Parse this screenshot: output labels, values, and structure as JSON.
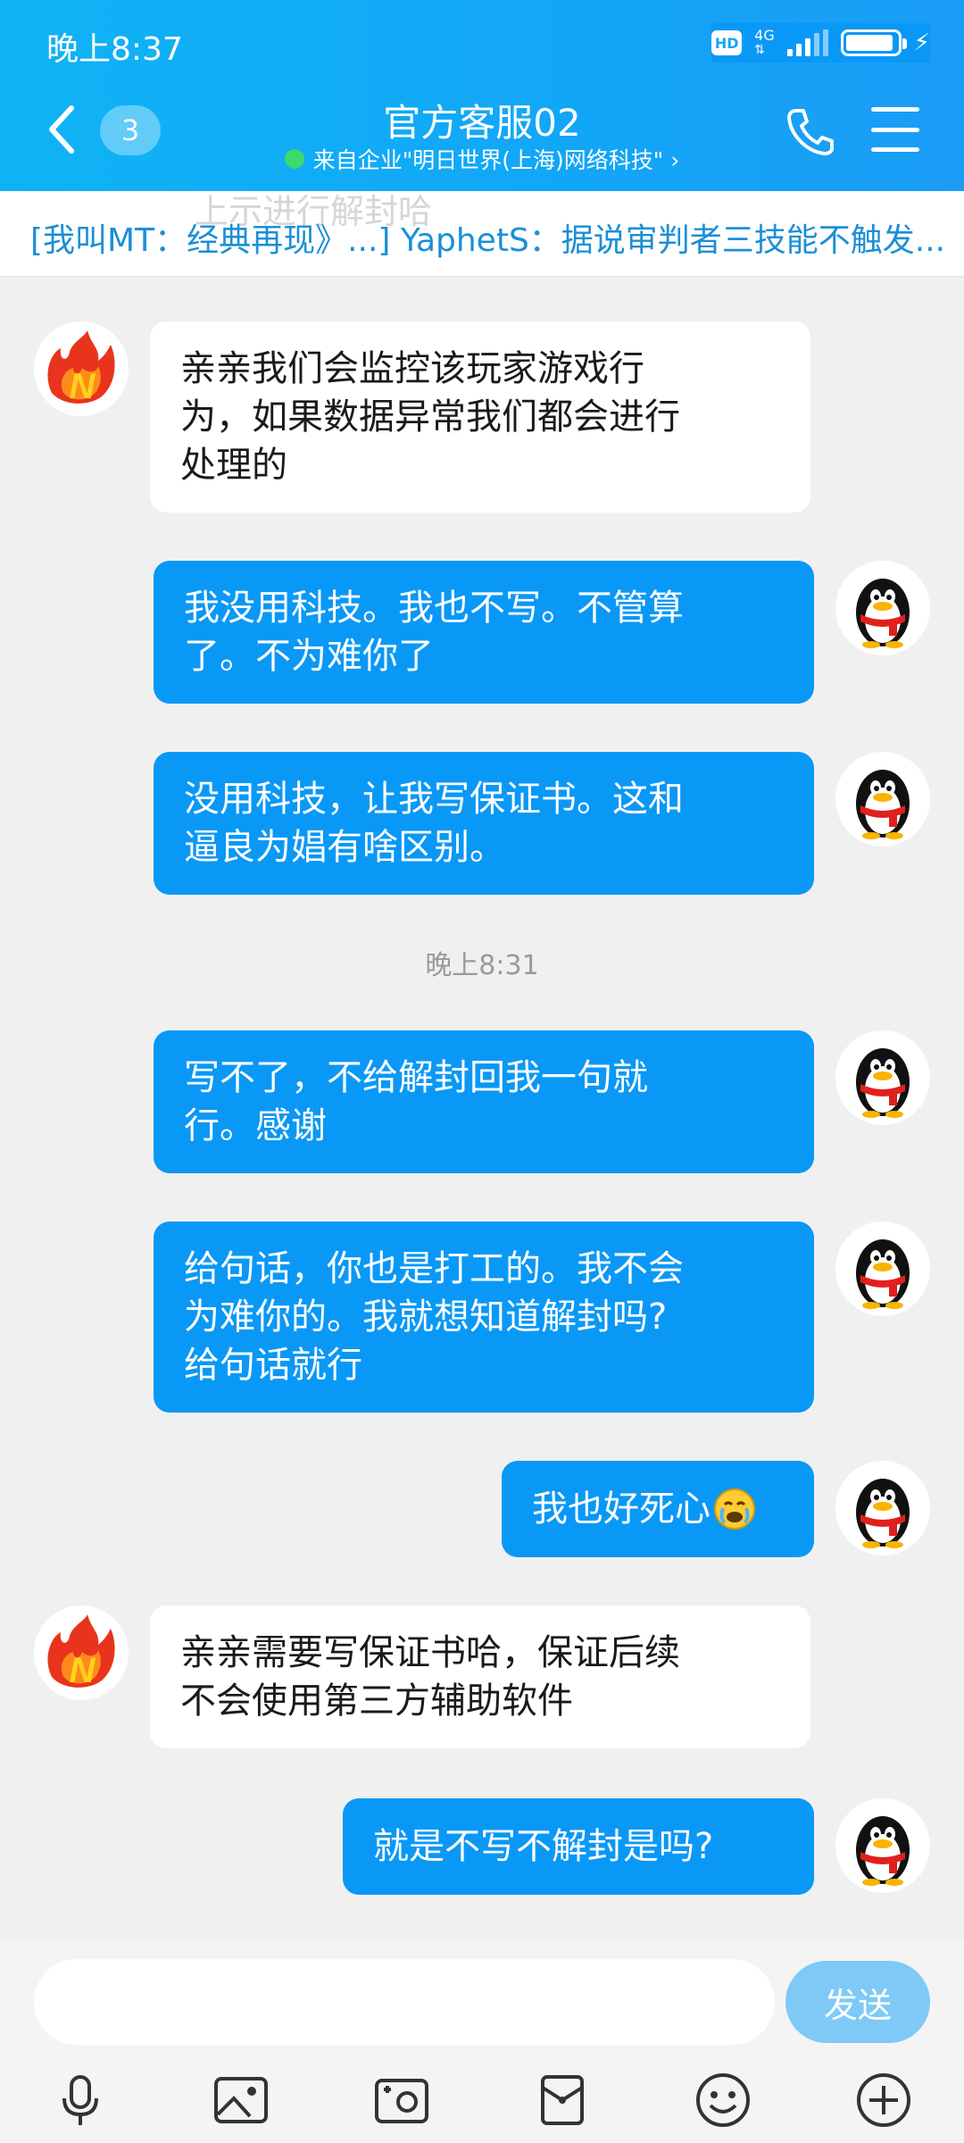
{
  "status_bar": {
    "time": "晚上8:37",
    "hd": "HD",
    "net": "4G"
  },
  "header": {
    "back_badge": "3",
    "title": "官方客服02",
    "subtitle": "来自企业\"明日世界(上海)网络科技\" ›"
  },
  "ticker": {
    "ghost_text": "上示进行解封哈",
    "text": "[我叫MT：经典再现》...] YaphetS：据说审判者三技能不触发..."
  },
  "messages": [
    {
      "side": "left",
      "lines": [
        "亲亲我们会监控该玩家游戏行",
        "为，如果数据异常我们都会进行",
        "处理的"
      ]
    },
    {
      "side": "right",
      "lines": [
        "我没用科技。我也不写。不管算",
        "了。不为难你了"
      ]
    },
    {
      "side": "right",
      "lines": [
        "没用科技，让我写保证书。这和",
        "逼良为娼有啥区别。"
      ]
    },
    {
      "side": "right",
      "lines": [
        "写不了，不给解封回我一句就",
        "行。感谢"
      ]
    },
    {
      "side": "right",
      "lines": [
        "给句话，你也是打工的。我不会",
        "为难你的。我就想知道解封吗?",
        "给句话就行"
      ]
    },
    {
      "side": "right",
      "lines": [
        "我也好死心"
      ],
      "emoji": "crying-face"
    },
    {
      "side": "left",
      "lines": [
        "亲亲需要写保证书哈，保证后续",
        "不会使用第三方辅助软件"
      ]
    },
    {
      "side": "right",
      "lines": [
        "就是不写不解封是吗?"
      ]
    }
  ],
  "timestamp": "晚上8:31",
  "composer": {
    "placeholder": "",
    "send_label": "发送"
  },
  "colors": {
    "header": "#12a6f7",
    "bubble_right": "#0a98f6",
    "bubble_left": "#ffffff",
    "send": "#7fc9f7"
  }
}
